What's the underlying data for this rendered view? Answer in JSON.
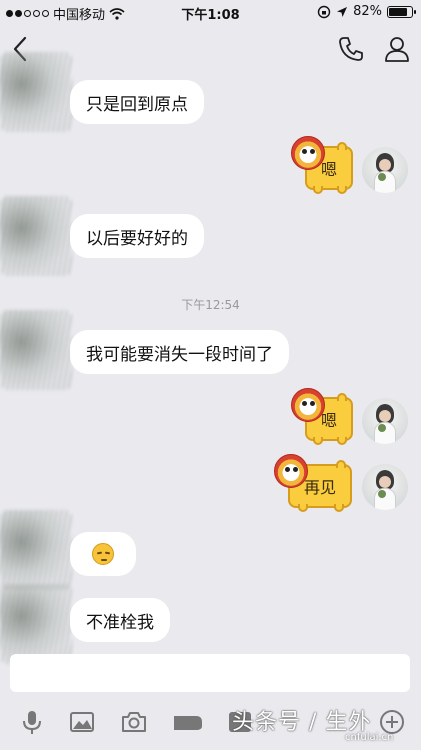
{
  "status_bar": {
    "carrier": "中国移动",
    "time": "下午1:08",
    "battery_percent": "82%",
    "battery_level": 0.82
  },
  "nav": {
    "back_icon": "chevron-left-icon",
    "call_icon": "phone-icon",
    "profile_icon": "person-icon"
  },
  "messages": [
    {
      "side": "left",
      "type": "text",
      "text": "只是回到原点"
    },
    {
      "side": "right",
      "type": "sticker",
      "text": "嗯"
    },
    {
      "side": "left",
      "type": "text",
      "text": "以后要好好的"
    },
    {
      "side": "center",
      "type": "timestamp",
      "text": "下午12:54"
    },
    {
      "side": "left",
      "type": "text",
      "text": "我可能要消失一段时间了"
    },
    {
      "side": "right",
      "type": "sticker",
      "text": "嗯"
    },
    {
      "side": "right",
      "type": "sticker",
      "text": "再见"
    },
    {
      "side": "left",
      "type": "emoji",
      "icon": "pensive-face-icon"
    },
    {
      "side": "left",
      "type": "text",
      "text": "不准栓我"
    }
  ],
  "toolbar": {
    "icons": [
      "microphone-icon",
      "image-icon",
      "camera-icon",
      "hongbao-icon",
      "emoji-icon",
      "plus-icon"
    ]
  },
  "watermark": {
    "text": "头条号 / 生外",
    "url": "cnfulai.cn"
  },
  "colors": {
    "background": "#e9e9ee",
    "sticker_fill": "#f9cd3d",
    "sticker_border": "#d79b1d"
  }
}
